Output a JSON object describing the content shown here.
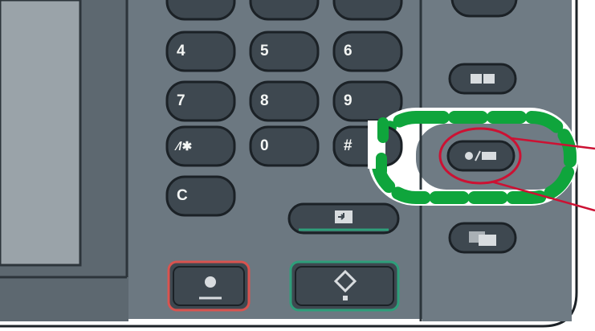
{
  "keypad": {
    "keys": [
      {
        "id": "4",
        "label": "4"
      },
      {
        "id": "5",
        "label": "5"
      },
      {
        "id": "6",
        "label": "6"
      },
      {
        "id": "7",
        "label": "7"
      },
      {
        "id": "8",
        "label": "8"
      },
      {
        "id": "9",
        "label": "9"
      },
      {
        "id": "star",
        "label": "∕/✱"
      },
      {
        "id": "0",
        "label": "0"
      },
      {
        "id": "hash",
        "label": "#"
      },
      {
        "id": "clear",
        "label": "C"
      }
    ]
  },
  "side_buttons": [
    {
      "id": "display",
      "icon": "display-icon"
    },
    {
      "id": "energy-saver",
      "icon": "energy-saver-icon",
      "highlighted": true
    },
    {
      "id": "simple-screen",
      "icon": "simple-screen-icon"
    }
  ],
  "bottom_buttons": [
    {
      "id": "stop",
      "icon": "stop-icon",
      "accent": "#d9534f"
    },
    {
      "id": "start",
      "icon": "start-icon",
      "accent": "#2e9e7a"
    },
    {
      "id": "enter",
      "icon": "enter-icon",
      "accent": "#2e9e7a"
    }
  ],
  "colors": {
    "panel": "#6a767f",
    "panel_dark": "#4e5a62",
    "button": "#3d4850",
    "highlight_dashed": "#0fa53c",
    "callout_red": "#cc1133",
    "stop_accent": "#d9534f",
    "start_accent": "#2e9e7a"
  }
}
